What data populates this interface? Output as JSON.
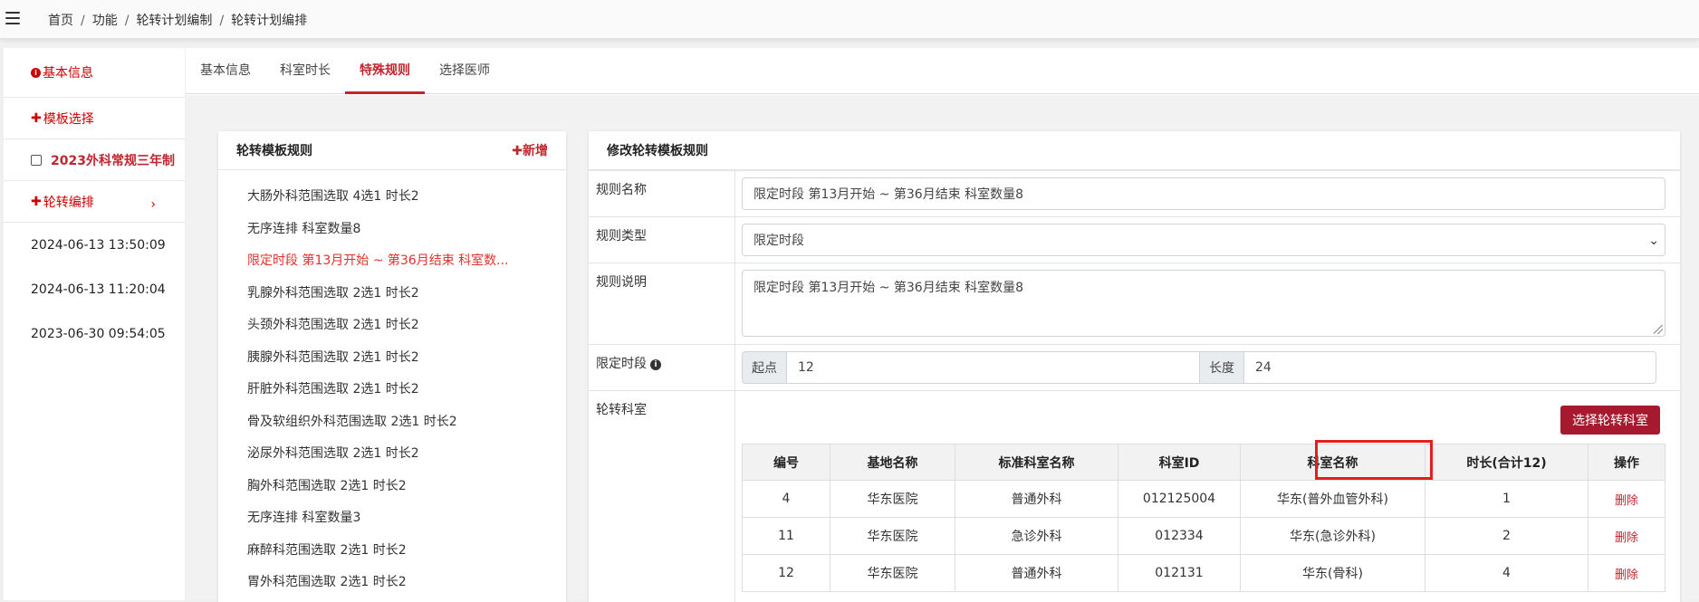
{
  "breadcrumb": [
    "首页",
    "功能",
    "轮转计划编制",
    "轮转计划编排"
  ],
  "sidebar": {
    "basic_info": "基本信息",
    "template_select": "模板选择",
    "plan_name": "2023外科常规三年制",
    "rotation_schedule": "轮转编排",
    "timestamps": [
      "2024-06-13 13:50:09",
      "2024-06-13 11:20:04",
      "2023-06-30 09:54:05"
    ]
  },
  "tabs": [
    {
      "label": "基本信息",
      "active": false
    },
    {
      "label": "科室时长",
      "active": false
    },
    {
      "label": "特殊规则",
      "active": true
    },
    {
      "label": "选择医师",
      "active": false
    }
  ],
  "rules_card": {
    "title": "轮转模板规则",
    "add_label": "✚新增",
    "items": [
      "大肠外科范围选取 4选1 时长2",
      "无序连排 科室数量8",
      "限定时段 第13月开始 ~ 第36月结束 科室数...",
      "乳腺外科范围选取 2选1 时长2",
      "头颈外科范围选取 2选1 时长2",
      "胰腺外科范围选取 2选1 时长2",
      "肝脏外科范围选取 2选1 时长2",
      "骨及软组织外科范围选取 2选1 时长2",
      "泌尿外科范围选取 2选1 时长2",
      "胸外科范围选取 2选1 时长2",
      "无序连排 科室数量3",
      "麻醉科范围选取 2选1 时长2",
      "胃外科范围选取 2选1 时长2"
    ],
    "active_index": 2
  },
  "edit_card": {
    "title": "修改轮转模板规则",
    "rule_name_label": "规则名称",
    "rule_name_value": "限定时段 第13月开始 ~ 第36月结束 科室数量8",
    "rule_type_label": "规则类型",
    "rule_type_value": "限定时段",
    "rule_desc_label": "规则说明",
    "rule_desc_value": "限定时段 第13月开始 ~ 第36月结束 科室数量8",
    "period_label": "限定时段",
    "start_label": "起点",
    "start_value": "12",
    "length_label": "长度",
    "length_value": "24",
    "dept_label": "轮转科室",
    "select_dept_button": "选择轮转科室",
    "table": {
      "headers": [
        "编号",
        "基地名称",
        "标准科室名称",
        "科室ID",
        "科室名称",
        "时长(合计12)",
        "操作"
      ],
      "rows": [
        [
          "4",
          "华东医院",
          "普通外科",
          "012125004",
          "华东(普外血管外科)",
          "1",
          "删除"
        ],
        [
          "11",
          "华东医院",
          "急诊外科",
          "012334",
          "华东(急诊外科)",
          "2",
          "删除"
        ],
        [
          "12",
          "华东医院",
          "普通外科",
          "012131",
          "华东(骨科)",
          "4",
          "删除"
        ]
      ]
    }
  },
  "colors": {
    "accent": "#c0262d",
    "button": "#a6192e",
    "highlight_box": "#e41d1d"
  }
}
